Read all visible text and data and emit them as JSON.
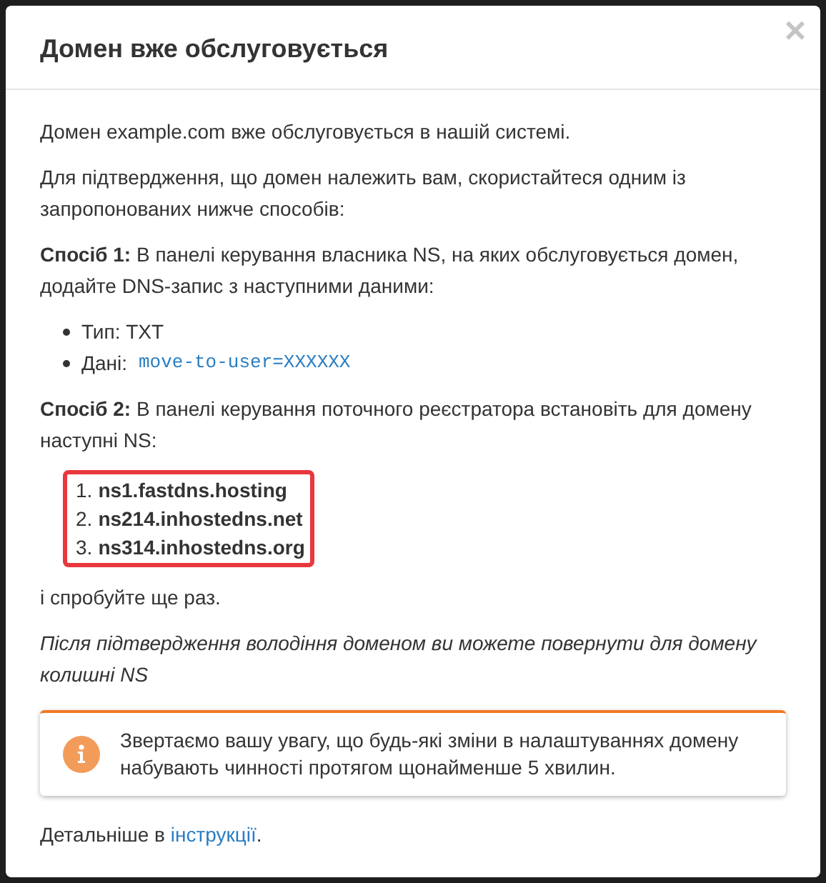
{
  "modal": {
    "title": "Домен вже обслуговується",
    "close": "×"
  },
  "intro": "Домен example.com вже обслуговується в нашій системі.",
  "prompt": "Для підтвердження, що домен належить вам, скористайтеся одним із запропонованих нижче способів:",
  "method_1": {
    "text": "**Спосіб 1:** В панелі керування власника NS, на яких обслуговується домен, додайте DNS-запис з наступними даними:",
    "records": [
      {
        "label": "Тип: TXT"
      },
      {
        "label": "Дані:",
        "code": "move-to-user=XXXXXX"
      }
    ]
  },
  "method_2": {
    "text": "**Спосіб 2:** В панелі керування поточного реєстратора встановіть для домену наступні NS:",
    "nameservers": [
      {
        "number": "1.",
        "name": "ns1.fastdns.hosting"
      },
      {
        "number": "2.",
        "name": "ns214.inhostedns.net"
      },
      {
        "number": "3.",
        "name": "ns314.inhostedns.org"
      }
    ]
  },
  "retry": "і спробуйте ще раз.",
  "note": "Після підтвердження володіння доменом ви можете повернути для домену колишні NS",
  "alert": {
    "text": "Звертаємо вашу увагу, що будь-які зміни в налаштуваннях домену набувають чинності протягом щонайменше 5 хвилин."
  },
  "footer": {
    "text": "Детальніше в",
    "link": "інструкції",
    "end": "."
  }
}
